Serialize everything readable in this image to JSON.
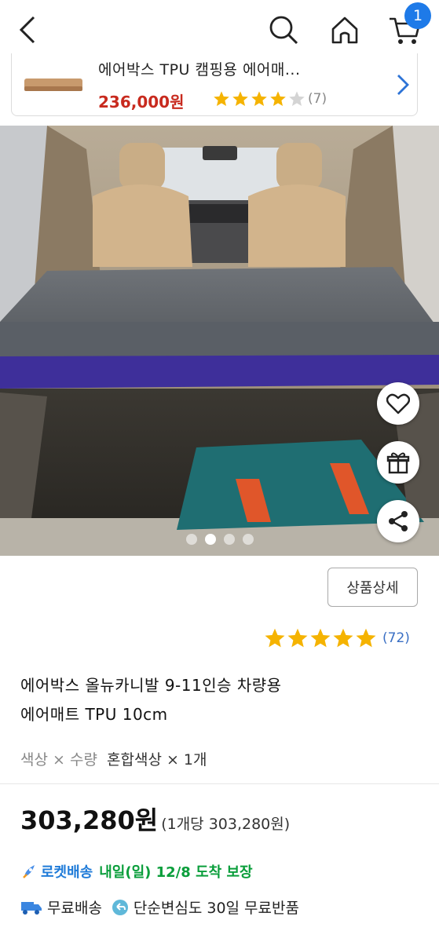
{
  "header": {
    "back": "back-icon",
    "search": "search-icon",
    "home": "home-icon",
    "cart": "cart-icon",
    "cart_count": "1",
    "accent": "#1e7ae8"
  },
  "recommended": {
    "title": "에어박스 TPU 캠핑용 에어매...",
    "price": "236,000원",
    "rating": 4,
    "review_count": "(7)",
    "price_color": "#c82a1e"
  },
  "gallery": {
    "image": "car interior with inflatable air mattress spanning the rear seating area",
    "slide_count": 4,
    "active_slide": 2,
    "actions": [
      "heart-icon",
      "gift-icon",
      "share-icon"
    ]
  },
  "product": {
    "detail_button": "상품상세",
    "rating": 5,
    "review_count": "(72)",
    "title_line1": "에어박스 올뉴카니발 9-11인승 차량용",
    "title_line2": "에어매트 TPU 10cm",
    "option_label": "색상 × 수량",
    "option_value": "혼합색상 × 1개",
    "price": "303,280원",
    "unit_price": "(1개당 303,280원)"
  },
  "delivery": {
    "badge": "로켓배송",
    "text": "내일(일) 12/8 도착 보장",
    "free_shipping": "무료배송",
    "free_return": "단순변심도 30일 무료반품",
    "rocket_color": "#1f7bd8",
    "arrival_color": "#0a9e3b"
  },
  "colors": {
    "star": "#f5b301",
    "star_empty": "#d4d4d4"
  }
}
